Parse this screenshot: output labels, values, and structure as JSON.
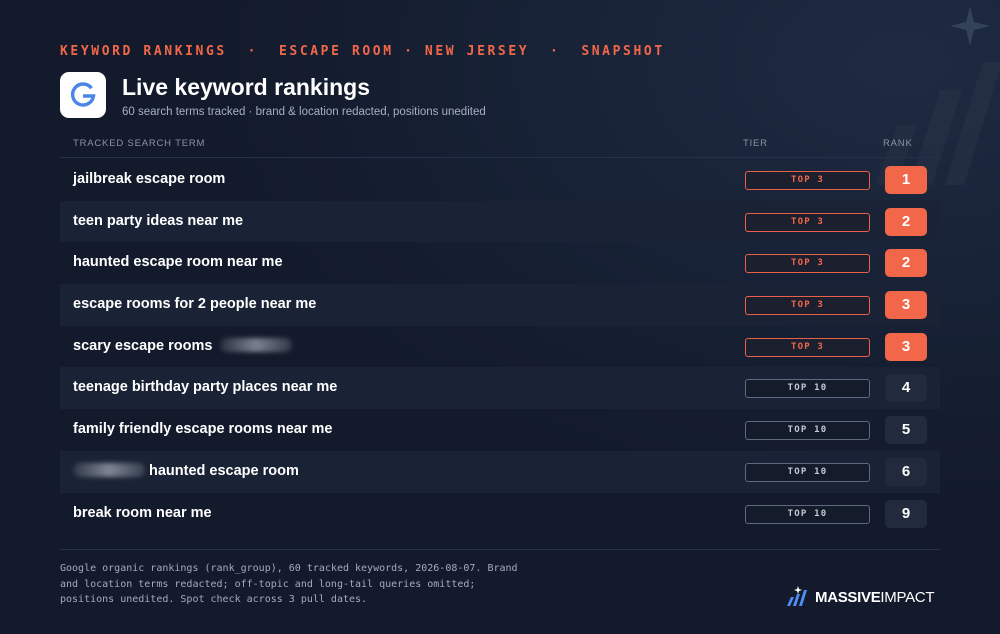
{
  "header": {
    "kicker": "KEYWORD RANKINGS  ·  ESCAPE ROOM · NEW JERSEY  ·  SNAPSHOT",
    "title": "Live keyword rankings",
    "subtitle": "60 search terms tracked · brand & location redacted, positions unedited",
    "logo_icon": "google-g-icon"
  },
  "table": {
    "headers": {
      "term": "TRACKED SEARCH TERM",
      "tier": "TIER",
      "rank": "RANK"
    },
    "rows": [
      {
        "term": "jailbreak escape room",
        "redaction": "none",
        "tier": "TOP 3",
        "rank": "1"
      },
      {
        "term": "teen party ideas near me",
        "redaction": "none",
        "tier": "TOP 3",
        "rank": "2"
      },
      {
        "term": "haunted escape room near me",
        "redaction": "none",
        "tier": "TOP 3",
        "rank": "2"
      },
      {
        "term": "escape rooms for 2 people near me",
        "redaction": "none",
        "tier": "TOP 3",
        "rank": "3"
      },
      {
        "term": "scary escape rooms",
        "redaction": "after",
        "tier": "TOP 3",
        "rank": "3"
      },
      {
        "term": "teenage birthday party places near me",
        "redaction": "none",
        "tier": "TOP 10",
        "rank": "4"
      },
      {
        "term": "family friendly escape rooms near me",
        "redaction": "none",
        "tier": "TOP 10",
        "rank": "5"
      },
      {
        "term": "haunted escape room",
        "redaction": "before",
        "tier": "TOP 10",
        "rank": "6"
      },
      {
        "term": "break room near me",
        "redaction": "none",
        "tier": "TOP 10",
        "rank": "9"
      }
    ]
  },
  "footer": {
    "note": "Google organic rankings (rank_group), 60 tracked keywords, 2026-08-07. Brand and location terms redacted; off-topic and long-tail queries omitted; positions unedited. Spot check across 3 pull dates.",
    "brand_bold": "MASSIVE",
    "brand_light": "IMPACT",
    "brand_icon": "massive-impact-logo-icon"
  },
  "colors": {
    "background": "#121a2b",
    "accent": "#f2674a",
    "row_alt": "#1a2335",
    "rank_neutral": "#222b3d"
  }
}
